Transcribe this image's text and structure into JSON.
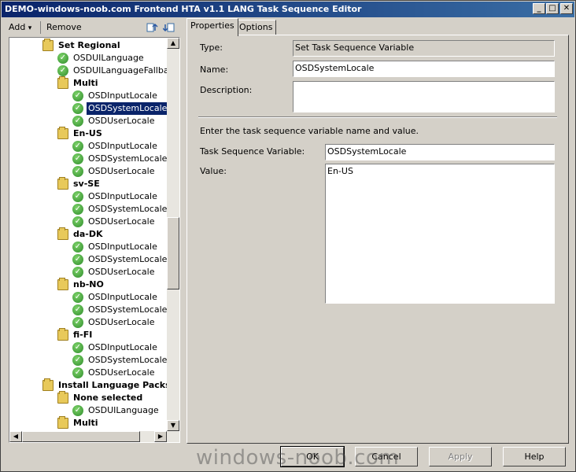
{
  "window": {
    "title": "DEMO-windows-noob.com Frontend HTA v1.1 LANG Task Sequence Editor",
    "controls": {
      "minimize": "_",
      "maximize": "□",
      "close": "✕"
    }
  },
  "toolbar": {
    "add_label": "Add",
    "add_arrow": "▾",
    "remove_label": "Remove"
  },
  "tree": {
    "items": [
      {
        "label": "Set Regional",
        "kind": "folder",
        "level": 0,
        "bold": true
      },
      {
        "label": "OSDUILanguage",
        "kind": "step",
        "level": 1
      },
      {
        "label": "OSDUILanguageFallback",
        "kind": "step",
        "level": 1
      },
      {
        "label": "Multi",
        "kind": "folder",
        "level": 1,
        "bold": true
      },
      {
        "label": "OSDInputLocale",
        "kind": "step",
        "level": 2
      },
      {
        "label": "OSDSystemLocale",
        "kind": "step",
        "level": 2,
        "selected": true
      },
      {
        "label": "OSDUserLocale",
        "kind": "step",
        "level": 2
      },
      {
        "label": "En-US",
        "kind": "folder",
        "level": 1,
        "bold": true
      },
      {
        "label": "OSDInputLocale",
        "kind": "step",
        "level": 2
      },
      {
        "label": "OSDSystemLocale",
        "kind": "step",
        "level": 2
      },
      {
        "label": "OSDUserLocale",
        "kind": "step",
        "level": 2
      },
      {
        "label": "sv-SE",
        "kind": "folder",
        "level": 1,
        "bold": true
      },
      {
        "label": "OSDInputLocale",
        "kind": "step",
        "level": 2
      },
      {
        "label": "OSDSystemLocale",
        "kind": "step",
        "level": 2
      },
      {
        "label": "OSDUserLocale",
        "kind": "step",
        "level": 2
      },
      {
        "label": "da-DK",
        "kind": "folder",
        "level": 1,
        "bold": true
      },
      {
        "label": "OSDInputLocale",
        "kind": "step",
        "level": 2
      },
      {
        "label": "OSDSystemLocale",
        "kind": "step",
        "level": 2
      },
      {
        "label": "OSDUserLocale",
        "kind": "step",
        "level": 2
      },
      {
        "label": "nb-NO",
        "kind": "folder",
        "level": 1,
        "bold": true
      },
      {
        "label": "OSDInputLocale",
        "kind": "step",
        "level": 2
      },
      {
        "label": "OSDSystemLocale",
        "kind": "step",
        "level": 2
      },
      {
        "label": "OSDUserLocale",
        "kind": "step",
        "level": 2
      },
      {
        "label": "fi-FI",
        "kind": "folder",
        "level": 1,
        "bold": true
      },
      {
        "label": "OSDInputLocale",
        "kind": "step",
        "level": 2
      },
      {
        "label": "OSDSystemLocale",
        "kind": "step",
        "level": 2
      },
      {
        "label": "OSDUserLocale",
        "kind": "step",
        "level": 2
      },
      {
        "label": "Install Language Packs C",
        "kind": "folder",
        "level": 0,
        "bold": true
      },
      {
        "label": "None selected",
        "kind": "folder",
        "level": 1,
        "bold": true
      },
      {
        "label": "OSDUILanguage",
        "kind": "step",
        "level": 2
      },
      {
        "label": "Multi",
        "kind": "folder",
        "level": 1,
        "bold": true
      }
    ],
    "scroll_up": "▲",
    "scroll_down": "▼",
    "scroll_left": "◀",
    "scroll_right": "▶"
  },
  "tabs": [
    {
      "label": "Properties",
      "active": true
    },
    {
      "label": "Options",
      "active": false
    }
  ],
  "properties": {
    "type_label": "Type:",
    "type_value": "Set Task Sequence Variable",
    "name_label": "Name:",
    "name_value": "OSDSystemLocale",
    "description_label": "Description:",
    "description_value": "",
    "instruction": "Enter the task sequence variable name and value.",
    "variable_label": "Task Sequence Variable:",
    "variable_value": "OSDSystemLocale",
    "value_label": "Value:",
    "value_value": "En-US"
  },
  "buttons": {
    "ok": "OK",
    "cancel": "Cancel",
    "apply": "Apply",
    "help": "Help"
  },
  "watermark": "windows-noob.com",
  "colors": {
    "titlebar": "#0a246a",
    "selection": "#0a246a",
    "face": "#d4d0c8"
  }
}
